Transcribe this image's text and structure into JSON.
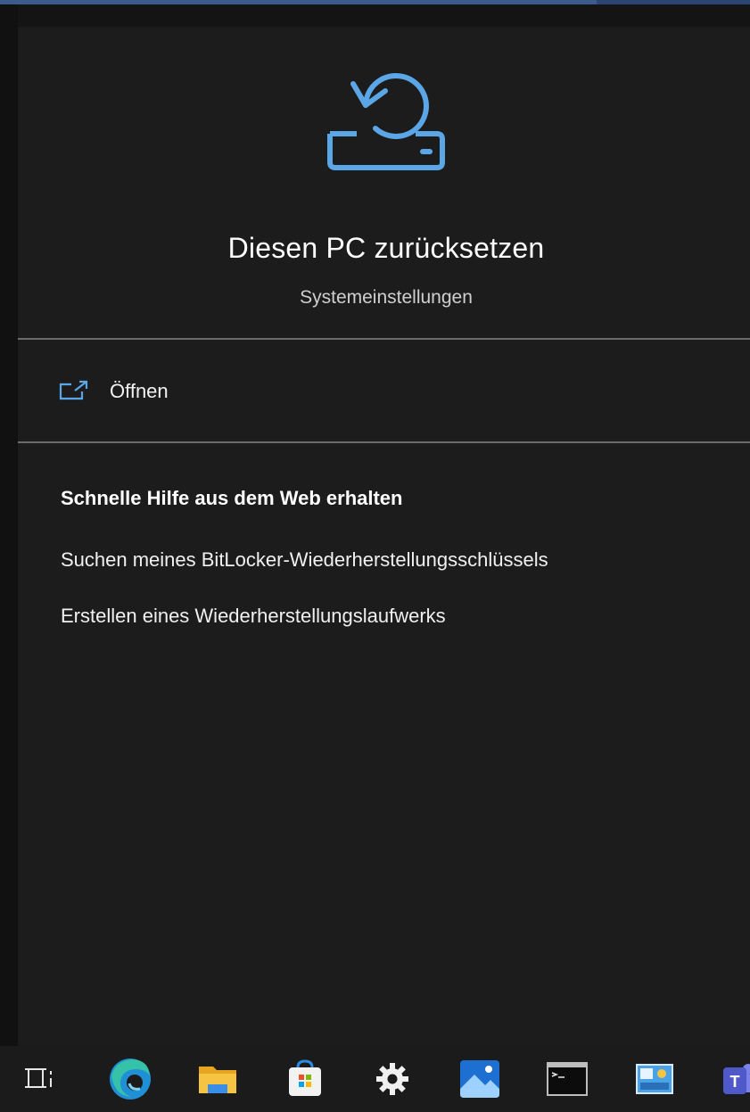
{
  "header": {
    "title": "Diesen PC zurücksetzen",
    "subtitle": "Systemeinstellungen",
    "icon": "reset-pc-icon"
  },
  "actions": {
    "open_label": "Öffnen",
    "open_icon": "open-external-icon"
  },
  "help": {
    "heading": "Schnelle Hilfe aus dem Web erhalten",
    "links": [
      "Suchen meines BitLocker-Wiederherstellungsschlüssels",
      "Erstellen eines Wiederherstellungslaufwerks"
    ]
  },
  "taskbar": {
    "items": [
      "task-view-icon",
      "edge-icon",
      "file-explorer-icon",
      "microsoft-store-icon",
      "settings-gear-icon",
      "photos-icon",
      "terminal-icon",
      "control-panel-icon",
      "teams-icon"
    ]
  },
  "colors": {
    "accent": "#5aa6e6",
    "panel_bg": "#1c1c1c",
    "divider": "#6b6b6b"
  }
}
